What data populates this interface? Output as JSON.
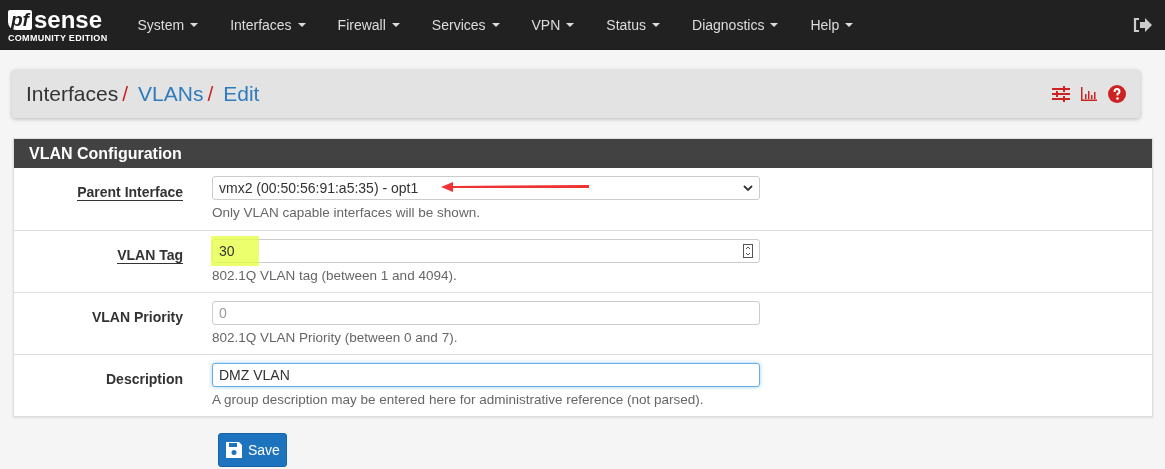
{
  "logo": {
    "mark": "pf",
    "name": "sense",
    "edition": "COMMUNITY EDITION"
  },
  "nav": [
    {
      "label": "System"
    },
    {
      "label": "Interfaces"
    },
    {
      "label": "Firewall"
    },
    {
      "label": "Services"
    },
    {
      "label": "VPN"
    },
    {
      "label": "Status"
    },
    {
      "label": "Diagnostics"
    },
    {
      "label": "Help"
    }
  ],
  "breadcrumb": [
    {
      "label": "Interfaces",
      "link": false,
      "separator": "/"
    },
    {
      "label": "VLANs",
      "link": true,
      "separator": "/"
    },
    {
      "label": "Edit",
      "link": true
    }
  ],
  "panel": {
    "title": "VLAN Configuration"
  },
  "fields": [
    {
      "kind": "select",
      "label": "Parent Interface",
      "required": true,
      "value": "vmx2 (00:50:56:91:a5:35) - opt1",
      "help": "Only VLAN capable interfaces will be shown.",
      "highlighted": false,
      "arrow": true,
      "focused": false
    },
    {
      "kind": "number",
      "label": "VLAN Tag",
      "required": true,
      "value": "30",
      "help": "802.1Q VLAN tag (between 1 and 4094).",
      "highlighted": true,
      "arrow": false,
      "focused": false
    },
    {
      "kind": "text",
      "label": "VLAN Priority",
      "required": false,
      "placeholder": "0",
      "help": "802.1Q VLAN Priority (between 0 and 7).",
      "highlighted": false,
      "arrow": false,
      "focused": false
    },
    {
      "kind": "text",
      "label": "Description",
      "required": false,
      "value": "DMZ VLAN",
      "help": "A group description may be entered here for administrative reference (not parsed).",
      "highlighted": false,
      "arrow": false,
      "focused": true
    }
  ],
  "save_button": {
    "label": "Save"
  }
}
